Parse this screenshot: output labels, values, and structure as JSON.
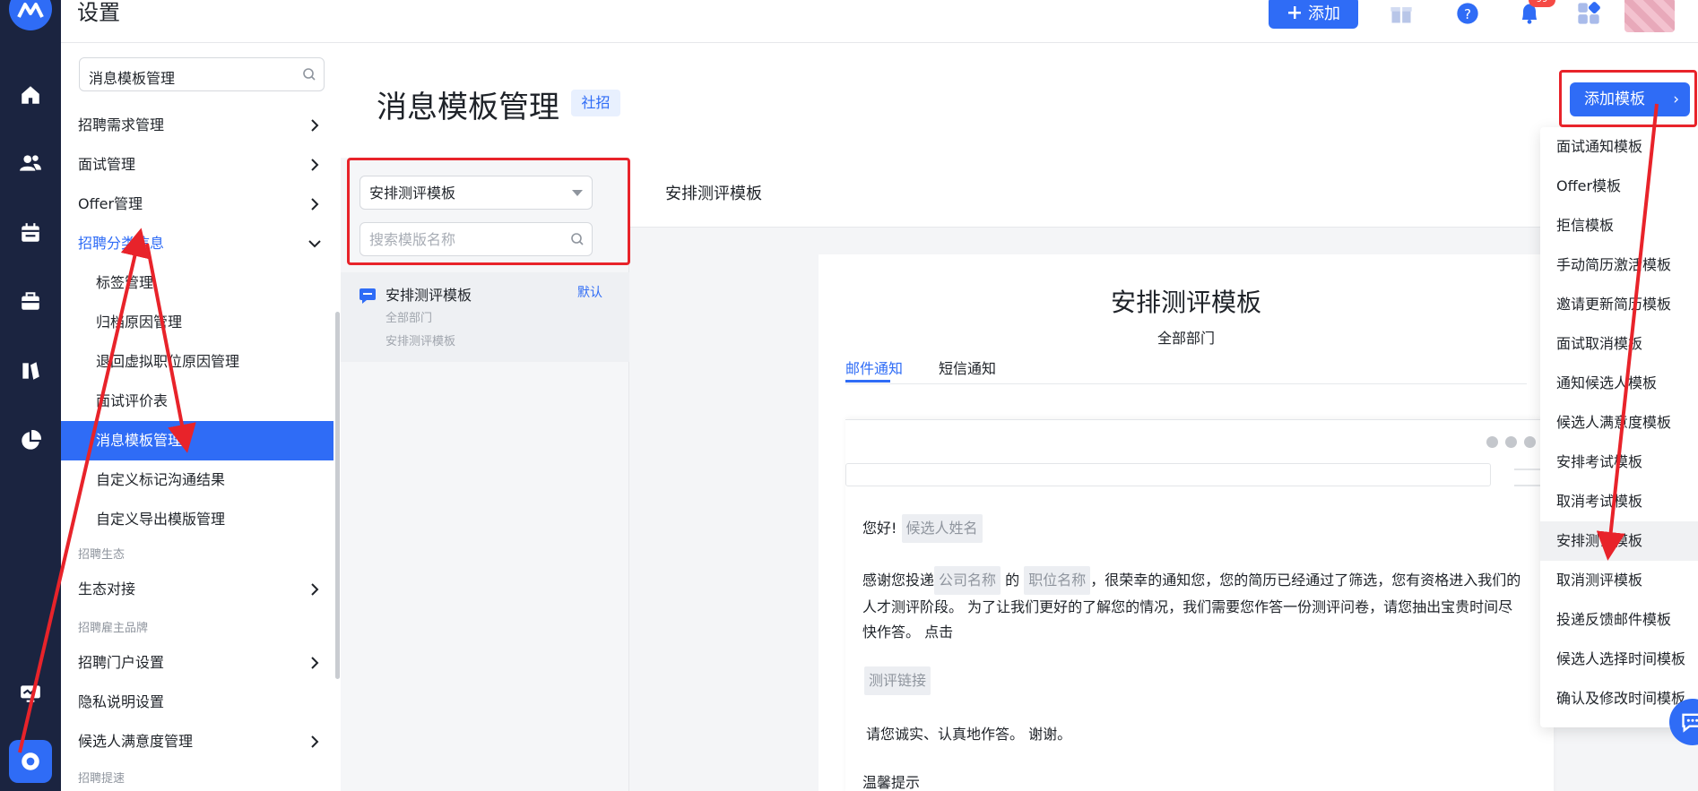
{
  "header": {
    "title": "设置",
    "add_button": "添加",
    "notification_badge": "99"
  },
  "sidebar": {
    "search_value": "消息模板管理",
    "items": [
      {
        "label": "招聘需求管理"
      },
      {
        "label": "面试管理"
      },
      {
        "label": "Offer管理"
      },
      {
        "label": "招聘分类信息"
      },
      {
        "label": "标签管理"
      },
      {
        "label": "归档原因管理"
      },
      {
        "label": "退回虚拟职位原因管理"
      },
      {
        "label": "面试评价表"
      },
      {
        "label": "消息模板管理"
      },
      {
        "label": "自定义标记沟通结果"
      },
      {
        "label": "自定义导出模版管理"
      },
      {
        "label": "生态对接"
      },
      {
        "label": "招聘门户设置"
      },
      {
        "label": "隐私说明设置"
      },
      {
        "label": "候选人满意度管理"
      }
    ],
    "groups": [
      "招聘生态",
      "招聘雇主品牌",
      "招聘提速"
    ]
  },
  "page": {
    "title": "消息模板管理",
    "tag": "社招",
    "add_template_button": "添加模板",
    "add_template_arrow": "›"
  },
  "template_list": {
    "type_select": "安排测评模板",
    "search_placeholder": "搜索模版名称",
    "card": {
      "name": "安排测评模板",
      "default_label": "默认",
      "department": "全部部门",
      "subtitle": "安排测评模板"
    }
  },
  "preview": {
    "header_title": "安排测评模板",
    "title": "安排测评模板",
    "department": "全部部门",
    "tabs": [
      "邮件通知",
      "短信通知"
    ],
    "greeting": "您好!",
    "candidate_name": "候选人姓名",
    "p1_a": "感谢您投递",
    "company_name": "公司名称",
    "p1_de": "的",
    "position_name": "职位名称",
    "p1_b": "，很荣幸的通知您，您的简历已经通过了筛选，您有资格进入我们的人才测评阶段。 为了让我们更好的了解您的情况，我们需要您作答一份测评问卷，请您抽出宝贵时间尽快作答。 点击",
    "eval_link": "测评链接",
    "p2": "请您诚实、认真地作答。 谢谢。",
    "tip": "温馨提示"
  },
  "dropdown": {
    "options": [
      "面试通知模板",
      "Offer模板",
      "拒信模板",
      "手动简历激活模板",
      "邀请更新简历模板",
      "面试取消模板",
      "通知候选人模板",
      "候选人满意度模板",
      "安排考试模板",
      "取消考试模板",
      "安排测评模板",
      "取消测评模板",
      "投递反馈邮件模板",
      "候选人选择时间模板",
      "确认及修改时间模板"
    ],
    "highlighted": "安排测评模板"
  },
  "colors": {
    "accent": "#2f6cf6",
    "rail": "#1b2440",
    "annotation_red": "#e8232a"
  }
}
